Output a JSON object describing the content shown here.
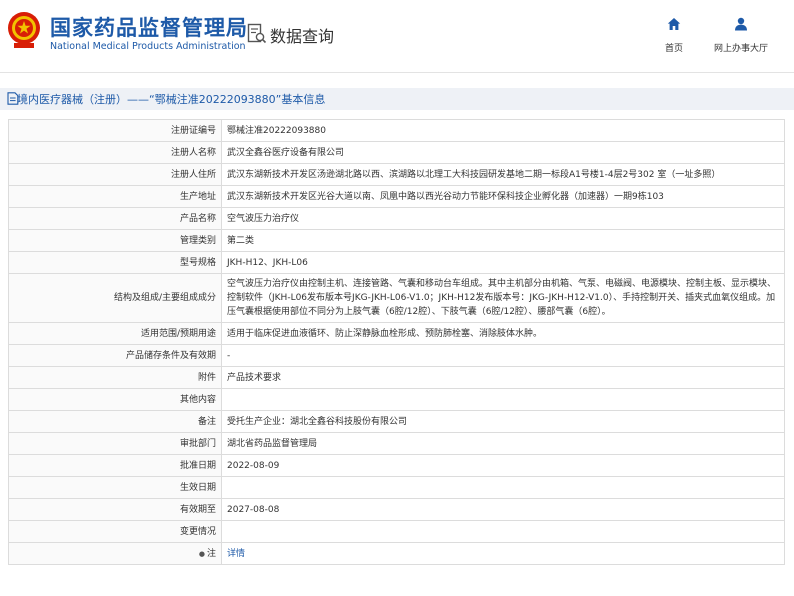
{
  "header": {
    "org_name_cn": "国家药品监督管理局",
    "org_name_en": "National Medical Products Administration",
    "data_query": "数据查询",
    "nav": {
      "home": "首页",
      "online_hall": "网上办事大厅"
    },
    "colors": {
      "brand_blue": "#1e5aa8"
    },
    "icons": [
      "national-emblem",
      "data-query-icon",
      "home-icon",
      "user-icon"
    ]
  },
  "page": {
    "title": "境内医疗器械（注册）——“鄂械注准20222093880”基本信息"
  },
  "record": [
    {
      "label": "注册证编号",
      "value": "鄂械注准20222093880"
    },
    {
      "label": "注册人名称",
      "value": "武汉全鑫谷医疗设备有限公司"
    },
    {
      "label": "注册人住所",
      "value": "武汉东湖新技术开发区汤逊湖北路以西、滨湖路以北理工大科技园研发基地二期一标段A1号楼1-4层2号302 室（一址多照）"
    },
    {
      "label": "生产地址",
      "value": "武汉东湖新技术开发区光谷大道以南、凤凰中路以西光谷动力节能环保科技企业孵化器（加速器）一期9栋103"
    },
    {
      "label": "产品名称",
      "value": "空气波压力治疗仪"
    },
    {
      "label": "管理类别",
      "value": "第二类"
    },
    {
      "label": "型号规格",
      "value": "JKH-H12、JKH-L06"
    },
    {
      "label": "结构及组成/主要组成成分",
      "value": "空气波压力治疗仪由控制主机、连接管路、气囊和移动台车组成。其中主机部分由机箱、气泵、电磁阀、电源模块、控制主板、显示模块、控制软件（JKH-L06发布版本号JKG-JKH-L06-V1.0；JKH-H12发布版本号：JKG-JKH-H12-V1.0）、手持控制开关、插夹式血氧仪组成。加压气囊根据使用部位不同分为上肢气囊（6腔/12腔）、下肢气囊（6腔/12腔）、腰部气囊（6腔）。"
    },
    {
      "label": "适用范围/预期用途",
      "value": "适用于临床促进血液循环、防止深静脉血栓形成、预防肺栓塞、消除肢体水肿。"
    },
    {
      "label": "产品储存条件及有效期",
      "value": "-"
    },
    {
      "label": "附件",
      "value": "产品技术要求"
    },
    {
      "label": "其他内容",
      "value": ""
    },
    {
      "label": "备注",
      "value": "受托生产企业：湖北全鑫谷科技股份有限公司"
    },
    {
      "label": "审批部门",
      "value": "湖北省药品监督管理局"
    },
    {
      "label": "批准日期",
      "value": "2022-08-09"
    },
    {
      "label": "生效日期",
      "value": ""
    },
    {
      "label": "有效期至",
      "value": "2027-08-08"
    },
    {
      "label": "变更情况",
      "value": ""
    },
    {
      "label": "注",
      "value": "详情"
    }
  ]
}
